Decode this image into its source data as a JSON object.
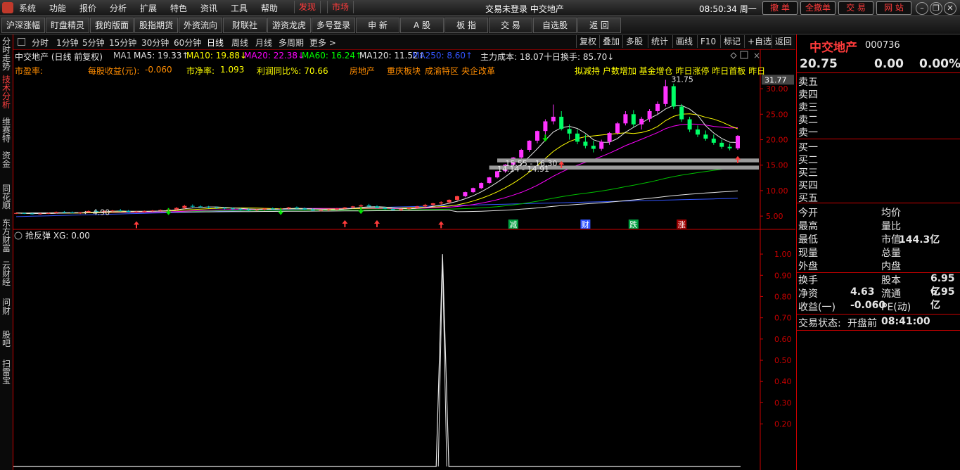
{
  "menu": {
    "items": [
      "系统",
      "功能",
      "报价",
      "分析",
      "扩展",
      "特色",
      "资讯",
      "工具",
      "帮助"
    ],
    "hot_items": [
      "发现",
      "市场"
    ],
    "status": "交易未登录   中交地产",
    "clock": "08:50:34 周一",
    "right_buttons": [
      "撤 单",
      "全撤单",
      "交 易",
      "网 站"
    ]
  },
  "toolbar": {
    "buttons": [
      "沪深涨幅",
      "盯盘精灵",
      "我的版面",
      "股指期货",
      "外资流向",
      "财联社",
      "游资龙虎",
      "多号登录",
      "申 新",
      "A 股",
      "板 指",
      "交 易",
      "自选股",
      "返 回"
    ]
  },
  "left_tabs": [
    "分时走势",
    "技术分析",
    "维赛特",
    "资金",
    "同花顺",
    "东方财富",
    "云财经",
    "问财",
    "股吧",
    "扫雷宝"
  ],
  "left_active": 1,
  "periods": [
    "分时",
    "1分钟",
    "5分钟",
    "15分钟",
    "30分钟",
    "60分钟",
    "日线",
    "周线",
    "月线",
    "多周期",
    "更多 >"
  ],
  "period_active": 6,
  "right_tools": [
    "复权",
    "叠加",
    "多股",
    "统计",
    "画线",
    "F10",
    "标记",
    "+自选",
    "返回"
  ],
  "ma_row": {
    "title": "中交地产 (日线 前复权)",
    "items": [
      {
        "text": "MA1",
        "color": "#cccccc"
      },
      {
        "text": "MA5: 19.33↑",
        "color": "#e6e6e6"
      },
      {
        "text": "MA10: 19.88↓",
        "color": "#ffff00"
      },
      {
        "text": "MA20: 22.38↓",
        "color": "#ff00ff"
      },
      {
        "text": "MA60: 16.24↑",
        "color": "#00ff00"
      },
      {
        "text": "MA120: 11.52↑",
        "color": "#e6e6e6"
      },
      {
        "text": "MA250: 8.60↑",
        "color": "#3355ff"
      },
      {
        "text": "主力成本: 18.07",
        "color": "#e6e6e6"
      },
      {
        "text": "十日换手: 85.70↓",
        "color": "#e6e6e6"
      }
    ]
  },
  "fund_row": {
    "items": [
      {
        "text": "市盈率:",
        "color": "#ff8c00"
      },
      {
        "text": "每股收益(元):",
        "color": "#ff8c00"
      },
      {
        "text": "-0.060",
        "color": "#ff8c00"
      },
      {
        "text": "市净率:",
        "color": "#ffff00"
      },
      {
        "text": "1.093",
        "color": "#ffff00"
      },
      {
        "text": "利润同比%: 70.66",
        "color": "#ffff00"
      },
      {
        "text": "房地产",
        "color": "#ff8c00"
      },
      {
        "text": "重庆板块",
        "color": "#ff8c00"
      },
      {
        "text": "成渝特区",
        "color": "#ff8c00"
      },
      {
        "text": "央企改革",
        "color": "#ff8c00"
      }
    ],
    "tags": "拟减持  户数增加  基金增仓  昨日涨停  昨日首板  昨日"
  },
  "chart_data": [
    {
      "type": "candlestick",
      "title": "中交地产 (日线 前复权)",
      "ylim": [
        3.5,
        32.5
      ],
      "y_ticks": [
        "30.00",
        "25.00",
        "20.00",
        "15.00",
        "10.00",
        "5.00"
      ],
      "last_price_label": "31.77",
      "high_label": "31.75",
      "low_label": "4.90",
      "support_labels": [
        "15.55 - 16.30",
        "14.14 - 14.91"
      ],
      "event_tags": [
        "减",
        "财",
        "跌",
        "涨"
      ],
      "ohlc": [
        [
          5.5,
          5.7,
          5.4,
          5.6
        ],
        [
          5.6,
          5.7,
          5.4,
          5.5
        ],
        [
          5.5,
          5.6,
          5.3,
          5.4
        ],
        [
          5.4,
          5.6,
          5.3,
          5.5
        ],
        [
          5.5,
          5.7,
          5.4,
          5.6
        ],
        [
          5.6,
          5.9,
          5.5,
          5.8
        ],
        [
          5.8,
          6.0,
          5.6,
          5.7
        ],
        [
          5.7,
          5.9,
          5.5,
          5.6
        ],
        [
          5.6,
          5.8,
          5.4,
          5.7
        ],
        [
          5.7,
          6.1,
          5.6,
          6.0
        ],
        [
          6.0,
          6.3,
          5.8,
          5.9
        ],
        [
          5.9,
          6.1,
          5.7,
          6.0
        ],
        [
          6.0,
          6.2,
          5.8,
          6.1
        ],
        [
          6.1,
          6.4,
          5.9,
          6.0
        ],
        [
          6.0,
          6.2,
          5.7,
          5.8
        ],
        [
          5.8,
          6.0,
          5.6,
          5.9
        ],
        [
          5.9,
          6.1,
          5.7,
          6.0
        ],
        [
          6.0,
          6.2,
          5.8,
          6.1
        ],
        [
          6.1,
          6.3,
          5.9,
          6.2
        ],
        [
          6.2,
          6.5,
          6.0,
          6.3
        ],
        [
          6.3,
          6.8,
          6.1,
          6.6
        ],
        [
          6.6,
          7.2,
          6.4,
          7.0
        ],
        [
          7.0,
          7.3,
          6.7,
          6.9
        ],
        [
          6.9,
          7.1,
          6.6,
          6.8
        ],
        [
          6.8,
          7.0,
          6.5,
          6.7
        ],
        [
          6.7,
          6.9,
          6.4,
          6.6
        ],
        [
          6.6,
          6.8,
          6.3,
          6.5
        ],
        [
          6.5,
          6.7,
          6.2,
          6.4
        ],
        [
          6.4,
          6.6,
          6.1,
          6.3
        ],
        [
          6.3,
          6.5,
          6.0,
          6.2
        ],
        [
          6.2,
          6.4,
          6.0,
          6.3
        ],
        [
          6.3,
          6.6,
          6.1,
          6.5
        ],
        [
          6.5,
          6.7,
          6.3,
          6.4
        ],
        [
          6.4,
          6.6,
          6.2,
          6.5
        ],
        [
          6.5,
          6.8,
          6.3,
          6.7
        ],
        [
          6.7,
          6.9,
          6.4,
          6.5
        ],
        [
          6.5,
          6.7,
          6.2,
          6.3
        ],
        [
          6.3,
          6.5,
          6.0,
          6.1
        ],
        [
          6.1,
          6.3,
          5.9,
          6.2
        ],
        [
          6.2,
          6.4,
          6.0,
          6.3
        ],
        [
          6.3,
          6.6,
          6.1,
          6.5
        ],
        [
          6.5,
          6.8,
          6.3,
          6.7
        ],
        [
          6.7,
          7.0,
          6.5,
          6.9
        ],
        [
          6.9,
          7.3,
          6.7,
          7.1
        ],
        [
          7.1,
          7.4,
          6.8,
          6.9
        ],
        [
          6.9,
          7.1,
          6.5,
          6.6
        ],
        [
          6.6,
          6.8,
          6.3,
          6.4
        ],
        [
          6.4,
          6.6,
          6.1,
          6.2
        ],
        [
          6.2,
          6.5,
          6.0,
          6.4
        ],
        [
          6.4,
          6.7,
          6.2,
          6.6
        ],
        [
          6.6,
          7.0,
          6.4,
          6.9
        ],
        [
          6.9,
          7.4,
          6.7,
          7.2
        ],
        [
          7.2,
          7.6,
          7.0,
          7.5
        ],
        [
          7.5,
          7.9,
          7.2,
          7.7
        ],
        [
          7.7,
          8.3,
          7.5,
          8.2
        ],
        [
          8.2,
          9.0,
          8.0,
          8.9
        ],
        [
          8.9,
          9.8,
          8.7,
          9.7
        ],
        [
          9.7,
          10.6,
          9.5,
          10.5
        ],
        [
          10.5,
          11.6,
          10.3,
          11.5
        ],
        [
          11.5,
          12.7,
          11.3,
          12.6
        ],
        [
          12.6,
          13.9,
          12.4,
          13.8
        ],
        [
          13.8,
          15.2,
          13.5,
          15.1
        ],
        [
          15.1,
          16.6,
          14.8,
          16.5
        ],
        [
          16.5,
          18.2,
          16.2,
          18.0
        ],
        [
          18.0,
          19.9,
          17.6,
          19.8
        ],
        [
          19.8,
          21.8,
          19.3,
          21.7
        ],
        [
          21.7,
          24.0,
          21.0,
          23.6
        ],
        [
          23.6,
          26.9,
          23.0,
          24.5
        ],
        [
          24.5,
          25.6,
          21.8,
          22.1
        ],
        [
          22.1,
          23.0,
          20.0,
          21.2
        ],
        [
          21.2,
          22.0,
          19.1,
          19.6
        ],
        [
          19.6,
          21.0,
          18.3,
          18.8
        ],
        [
          18.8,
          19.8,
          17.5,
          18.2
        ],
        [
          18.2,
          20.0,
          17.8,
          19.6
        ],
        [
          19.6,
          21.5,
          19.0,
          21.3
        ],
        [
          21.3,
          23.5,
          21.0,
          23.2
        ],
        [
          23.2,
          25.6,
          22.8,
          25.0
        ],
        [
          25.0,
          25.8,
          22.5,
          23.0
        ],
        [
          23.0,
          24.5,
          22.0,
          24.1
        ],
        [
          24.1,
          26.0,
          23.5,
          25.6
        ],
        [
          25.6,
          27.5,
          25.0,
          27.0
        ],
        [
          27.0,
          31.75,
          26.5,
          30.5
        ],
        [
          30.5,
          31.0,
          26.0,
          26.5
        ],
        [
          26.5,
          27.0,
          23.5,
          24.0
        ],
        [
          24.0,
          24.5,
          21.5,
          22.0
        ],
        [
          22.0,
          22.8,
          20.5,
          21.0
        ],
        [
          21.0,
          21.8,
          19.8,
          20.2
        ],
        [
          20.2,
          21.0,
          19.0,
          19.4
        ],
        [
          19.4,
          20.0,
          18.2,
          18.6
        ],
        [
          18.6,
          19.2,
          17.9,
          18.3
        ],
        [
          18.3,
          20.9,
          18.0,
          20.75
        ]
      ]
    },
    {
      "type": "line",
      "title": "抢反弹 XG: 0.00",
      "ylim": [
        0,
        1.05
      ],
      "y_ticks": [
        "1.00",
        "0.90",
        "0.80",
        "0.70",
        "0.60",
        "0.50",
        "0.40",
        "0.30",
        "0.20"
      ],
      "series": [
        {
          "name": "XG",
          "spike_bar_index": 53,
          "spike_value": 1.0
        }
      ]
    }
  ],
  "quote": {
    "name": "中交地产",
    "code": "000736",
    "price": "20.75",
    "change": "0.00",
    "pct": "0.00%",
    "asks": [
      "卖五",
      "卖四",
      "卖三",
      "卖二",
      "卖一"
    ],
    "bids": [
      "买一",
      "买二",
      "买三",
      "买四",
      "买五"
    ],
    "stats_left": [
      "今开",
      "最高",
      "最低",
      "现量",
      "外盘"
    ],
    "stats_right": [
      "均价",
      "量比",
      "市值",
      "总量",
      "内盘"
    ],
    "market_cap": "144.3亿",
    "turnover_label": "换手",
    "share_capital_label": "股本",
    "share_capital": "6.95亿",
    "net_assets_label": "净资",
    "net_assets": "4.63",
    "float_label": "流通",
    "float": "6.95亿",
    "eps_label": "收益(一)",
    "eps": "-0.060",
    "pe_label": "PE(动)",
    "trade_status_label": "交易状态:",
    "trade_status": "开盘前",
    "trade_time": "08:41:00"
  },
  "colors": {
    "up": "#ff3b3b",
    "down": "#00e600",
    "accent": "#cc0000"
  }
}
